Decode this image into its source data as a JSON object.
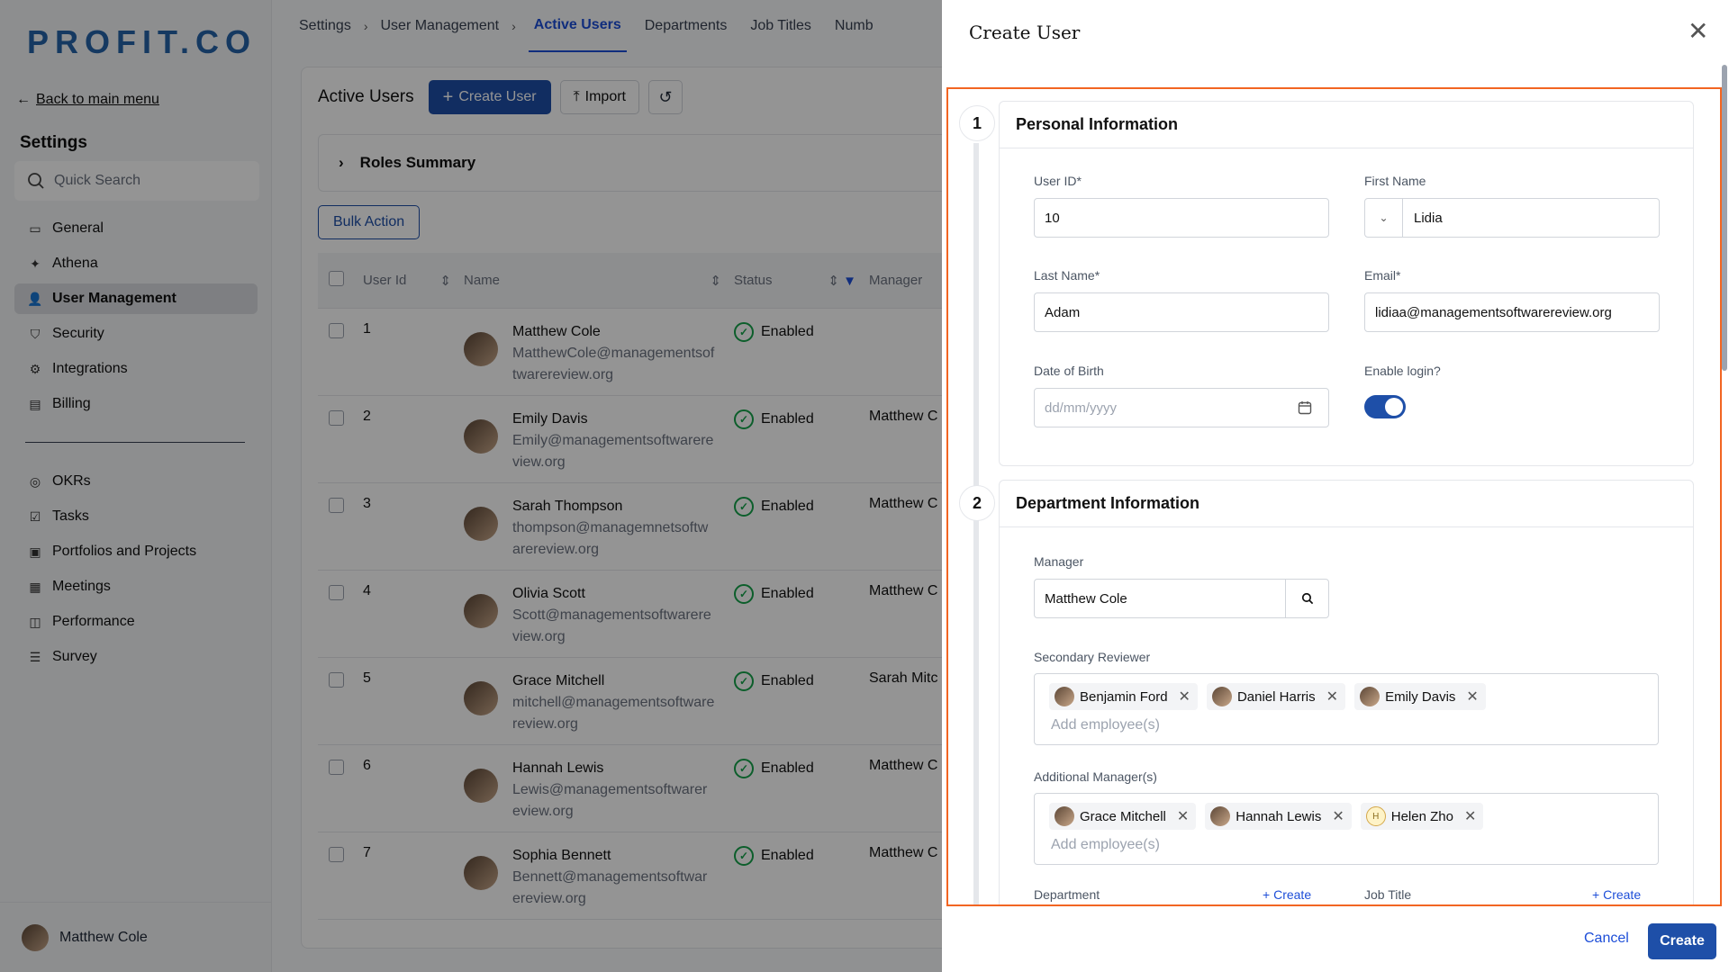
{
  "logo": "PROFIT.CO",
  "sidebar": {
    "back_label": "Back to main menu",
    "title": "Settings",
    "search_placeholder": "Quick Search",
    "items_top": [
      {
        "label": "General",
        "icon": "monitor-icon"
      },
      {
        "label": "Athena",
        "icon": "sparkle-icon"
      },
      {
        "label": "User Management",
        "icon": "user-icon",
        "active": true
      },
      {
        "label": "Security",
        "icon": "shield-icon"
      },
      {
        "label": "Integrations",
        "icon": "plug-icon"
      },
      {
        "label": "Billing",
        "icon": "receipt-icon"
      }
    ],
    "items_bottom": [
      {
        "label": "OKRs",
        "icon": "target-icon"
      },
      {
        "label": "Tasks",
        "icon": "checkbox-icon"
      },
      {
        "label": "Portfolios and Projects",
        "icon": "briefcase-icon"
      },
      {
        "label": "Meetings",
        "icon": "calendar-icon"
      },
      {
        "label": "Performance",
        "icon": "chart-icon"
      },
      {
        "label": "Survey",
        "icon": "survey-icon"
      }
    ],
    "current_user": "Matthew Cole"
  },
  "breadcrumb": {
    "settings": "Settings",
    "user_management": "User Management",
    "tabs": [
      "Active Users",
      "Departments",
      "Job Titles",
      "Numb"
    ]
  },
  "users_page": {
    "title": "Active Users",
    "create_user": "Create User",
    "import": "Import",
    "roles_summary": "Roles Summary",
    "bulk_action": "Bulk Action",
    "columns": {
      "id": "User Id",
      "name": "Name",
      "status": "Status",
      "manager": "Manager"
    },
    "rows": [
      {
        "id": "1",
        "name": "Matthew Cole",
        "email": "MatthewCole@managementsoftwarereview.org",
        "status": "Enabled",
        "manager": ""
      },
      {
        "id": "2",
        "name": "Emily Davis",
        "email": "Emily@managementsoftwarereview.org",
        "status": "Enabled",
        "manager": "Matthew C"
      },
      {
        "id": "3",
        "name": "Sarah Thompson",
        "email": "thompson@managemnetsoftwarereview.org",
        "status": "Enabled",
        "manager": "Matthew C"
      },
      {
        "id": "4",
        "name": "Olivia Scott",
        "email": "Scott@managementsoftwarereview.org",
        "status": "Enabled",
        "manager": "Matthew C"
      },
      {
        "id": "5",
        "name": "Grace Mitchell",
        "email": "mitchell@managementsoftwarereview.org",
        "status": "Enabled",
        "manager": "Sarah Mitc"
      },
      {
        "id": "6",
        "name": "Hannah Lewis",
        "email": "Lewis@managementsoftwarereview.org",
        "status": "Enabled",
        "manager": "Matthew C"
      },
      {
        "id": "7",
        "name": "Sophia Bennett",
        "email": "Bennett@managementsoftwarereview.org",
        "status": "Enabled",
        "manager": "Matthew C"
      }
    ]
  },
  "create_user": {
    "title": "Create User",
    "personal": {
      "step": "1",
      "heading": "Personal Information",
      "user_id_label": "User ID*",
      "user_id": "10",
      "first_name_label": "First Name",
      "first_name": "Lidia",
      "last_name_label": "Last Name*",
      "last_name": "Adam",
      "email_label": "Email*",
      "email": "lidiaa@managementsoftwarereview.org",
      "dob_label": "Date of Birth",
      "dob_placeholder": "dd/mm/yyyy",
      "enable_login_label": "Enable login?",
      "enable_login": true
    },
    "department": {
      "step": "2",
      "heading": "Department Information",
      "manager_label": "Manager",
      "manager": "Matthew  Cole",
      "secondary_reviewer_label": "Secondary Reviewer",
      "secondary_reviewers": [
        "Benjamin Ford",
        "Daniel Harris",
        "Emily Davis"
      ],
      "additional_managers_label": "Additional Manager(s)",
      "additional_managers": [
        "Grace Mitchell",
        "Hannah Lewis",
        "Helen Zho"
      ],
      "add_employee_placeholder": "Add employee(s)",
      "department_label": "Department",
      "job_title_label": "Job Title",
      "create_label": "Create"
    },
    "cancel": "Cancel",
    "create": "Create"
  },
  "colors": {
    "primary": "#1e4fa8",
    "focus_outline": "#f26522",
    "enabled": "#16a34a"
  }
}
